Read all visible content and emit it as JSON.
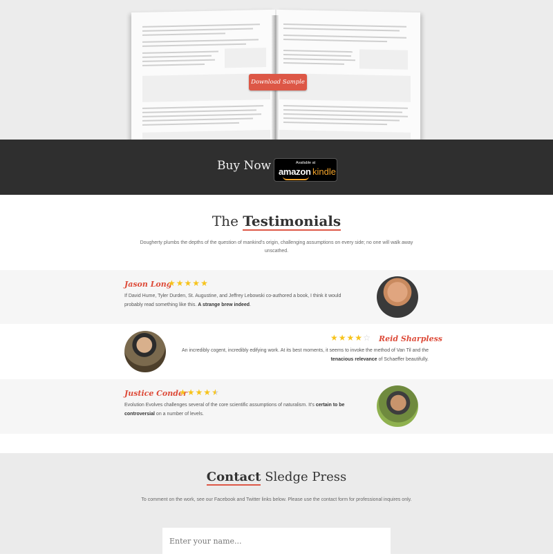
{
  "hero": {
    "download_label": "Download Sample"
  },
  "buy": {
    "label": "Buy Now",
    "badge_available": "Available at",
    "badge_brand": "amazon",
    "badge_product": "kindle"
  },
  "testimonials": {
    "title_prefix": "The",
    "title_bold": "Testimonials",
    "subtitle": "Dougherty plumbs the depths of the question of mankind's origin, challenging assumptions on every side; no one will walk away unscathed.",
    "items": [
      {
        "name": "Jason Long",
        "rating": 5,
        "text": "If David Hume, Tyler Durden, St. Augustine, and Jeffrey Lebowski co-authored a book, I think it would probably read something like this.",
        "highlight": "A strange brew indeed",
        "text_after": "."
      },
      {
        "name": "Reid Sharpless",
        "rating": 4,
        "text": "An incredibly cogent, incredibly edifying work. At its best moments, it seems to invoke the method of Van Til and the",
        "highlight": "tenacious relevance",
        "text_after": "of Schaeffer beautifully."
      },
      {
        "name": "Justice Conder",
        "rating": 4.5,
        "text": "Evolution Evolves challenges several of the core scientific assumptions of naturalism. It's",
        "highlight": "certain to be controversial",
        "text_after": "on a number of levels."
      }
    ]
  },
  "contact": {
    "title_bold": "Contact",
    "title_rest": "Sledge Press",
    "subtitle": "To comment on the work, see our Facebook and Twitter links below. Please use the contact form for professional inquires only.",
    "name_placeholder": "Enter your name..."
  },
  "colors": {
    "accent": "#dd5746",
    "star": "#f7c31b",
    "dark_bar": "#2f2f2f"
  }
}
